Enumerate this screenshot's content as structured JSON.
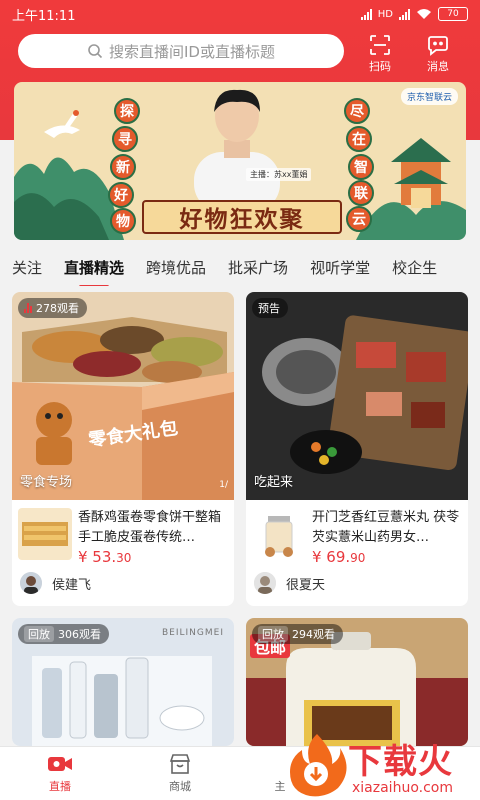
{
  "status_bar": {
    "time": "上午11:11",
    "network": "HD",
    "battery": "70"
  },
  "search": {
    "placeholder": "搜索直播间ID或直播标题"
  },
  "top_actions": {
    "scan": "扫码",
    "message": "消息"
  },
  "banner": {
    "left_chars": [
      "探",
      "寻",
      "新",
      "好",
      "物"
    ],
    "right_chars": [
      "尽",
      "在",
      "智",
      "联",
      "云"
    ],
    "title": "好物狂欢聚",
    "host": "主播：苏xx董娟",
    "brand": "京东智联云"
  },
  "tabs": [
    "关注",
    "直播精选",
    "跨境优品",
    "批采广场",
    "视听学堂",
    "校企生"
  ],
  "active_tab": "直播精选",
  "cards": [
    {
      "badge": "278观看",
      "caption": "零食专场",
      "count_tag": "1/",
      "product_title": "香酥鸡蛋卷零食饼干整箱手工脆皮蛋卷传统…",
      "price_main": "¥ 53.",
      "price_cents": "30",
      "anchor": "侯建飞",
      "box_text": "零食大礼包"
    },
    {
      "badge": "预告",
      "caption": "吃起来",
      "product_title": "开门芝香红豆薏米丸 茯苓芡实薏米山药男女…",
      "price_main": "¥ 69.",
      "price_cents": "90",
      "anchor": "很夏天"
    },
    {
      "badge": "回放",
      "badge_count": "306观看",
      "brand_text": "BEILINGMEI"
    },
    {
      "badge": "回放",
      "badge_count": "294观看",
      "corner_text": "包邮"
    }
  ],
  "bottom_nav": {
    "live": "直播",
    "mall": "商城",
    "third": "主"
  },
  "watermark": {
    "text": "下载火",
    "site": "xiazaihuo.com"
  },
  "colors": {
    "accent": "#e8383d",
    "header": "#f03a3c"
  }
}
